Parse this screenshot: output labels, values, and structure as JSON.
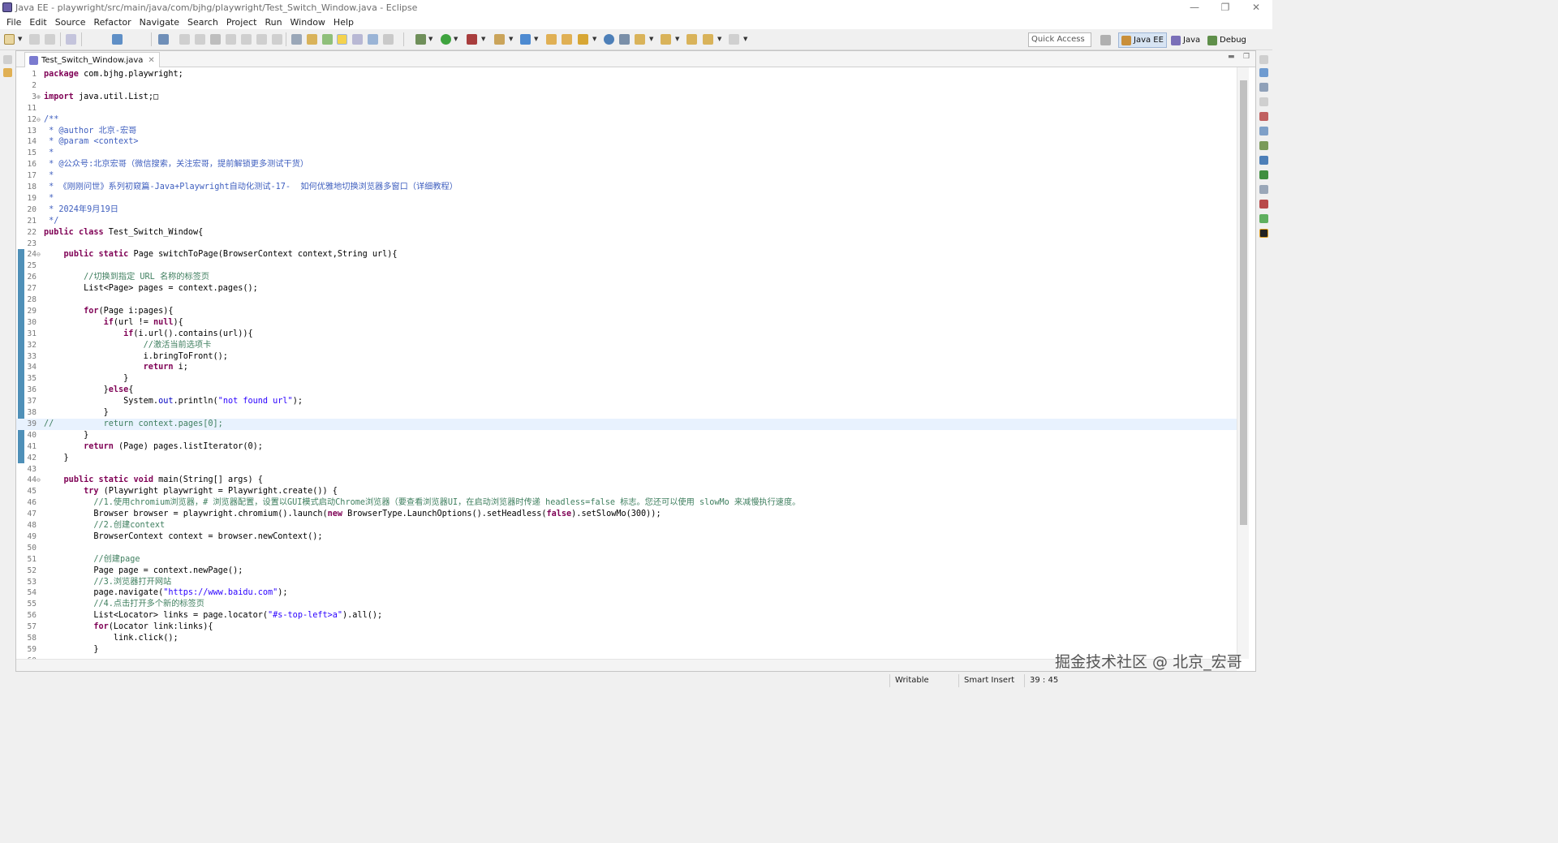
{
  "window": {
    "title": "Java EE - playwright/src/main/java/com/bjhg/playwright/Test_Switch_Window.java - Eclipse",
    "controls": [
      "—",
      "❐",
      "✕"
    ]
  },
  "menu": [
    "File",
    "Edit",
    "Source",
    "Refactor",
    "Navigate",
    "Search",
    "Project",
    "Run",
    "Window",
    "Help"
  ],
  "quick_access": {
    "placeholder": "Quick Access"
  },
  "perspectives": {
    "javaee": "Java EE",
    "java": "Java",
    "debug": "Debug"
  },
  "editor_tab": {
    "name": "Test_Switch_Window.java",
    "close": "✕"
  },
  "code_lines": [
    {
      "n": "1",
      "text": "package com.bjhg.playwright;"
    },
    {
      "n": "2",
      "text": ""
    },
    {
      "n": "3",
      "text": "import java.util.List;□",
      "fold": "⊕"
    },
    {
      "n": "11",
      "text": ""
    },
    {
      "n": "12",
      "text": "/**",
      "fold": "⊖"
    },
    {
      "n": "13",
      "text": " * @author 北京-宏哥"
    },
    {
      "n": "14",
      "text": " * @param <context>"
    },
    {
      "n": "15",
      "text": " *"
    },
    {
      "n": "16",
      "text": " * @公众号:北京宏哥（微信搜索，关注宏哥，提前解锁更多测试干货）"
    },
    {
      "n": "17",
      "text": " *"
    },
    {
      "n": "18",
      "text": " * 《刚刚问世》系列初窥篇-Java+Playwright自动化测试-17-  如何优雅地切换浏览器多窗口（详细教程）"
    },
    {
      "n": "19",
      "text": " *"
    },
    {
      "n": "20",
      "text": " * 2024年9月19日"
    },
    {
      "n": "21",
      "text": " */"
    },
    {
      "n": "22",
      "text": "public class Test_Switch_Window{"
    },
    {
      "n": "23",
      "text": ""
    },
    {
      "n": "24",
      "text": "    public static Page switchToPage(BrowserContext context,String url){",
      "fold": "⊖"
    },
    {
      "n": "25",
      "text": ""
    },
    {
      "n": "26",
      "text": "        //切换到指定 URL 名称的标签页"
    },
    {
      "n": "27",
      "text": "        List<Page> pages = context.pages();"
    },
    {
      "n": "28",
      "text": ""
    },
    {
      "n": "29",
      "text": "        for(Page i:pages){"
    },
    {
      "n": "30",
      "text": "            if(url != null){"
    },
    {
      "n": "31",
      "text": "                if(i.url().contains(url)){"
    },
    {
      "n": "32",
      "text": "                    //激活当前选项卡"
    },
    {
      "n": "33",
      "text": "                    i.bringToFront();"
    },
    {
      "n": "34",
      "text": "                    return i;"
    },
    {
      "n": "35",
      "text": "                }"
    },
    {
      "n": "36",
      "text": "            }else{"
    },
    {
      "n": "37",
      "text": "                System.out.println(\"not found url\");"
    },
    {
      "n": "38",
      "text": "            }"
    },
    {
      "n": "39",
      "text": "//          return context.pages[0];"
    },
    {
      "n": "40",
      "text": "        }"
    },
    {
      "n": "41",
      "text": "        return (Page) pages.listIterator(0);"
    },
    {
      "n": "42",
      "text": "    }"
    },
    {
      "n": "43",
      "text": ""
    },
    {
      "n": "44",
      "text": "    public static void main(String[] args) {",
      "fold": "⊖"
    },
    {
      "n": "45",
      "text": "        try (Playwright playwright = Playwright.create()) {"
    },
    {
      "n": "46",
      "text": "          //1.使用chromium浏览器，# 浏览器配置，设置以GUI模式启动Chrome浏览器（要查看浏览器UI，在启动浏览器时传递 headless=false 标志。您还可以使用 slowMo 来减慢执行速度。"
    },
    {
      "n": "47",
      "text": "          Browser browser = playwright.chromium().launch(new BrowserType.LaunchOptions().setHeadless(false).setSlowMo(300));"
    },
    {
      "n": "48",
      "text": "          //2.创建context"
    },
    {
      "n": "49",
      "text": "          BrowserContext context = browser.newContext();"
    },
    {
      "n": "50",
      "text": ""
    },
    {
      "n": "51",
      "text": "          //创建page"
    },
    {
      "n": "52",
      "text": "          Page page = context.newPage();"
    },
    {
      "n": "53",
      "text": "          //3.浏览器打开网站"
    },
    {
      "n": "54",
      "text": "          page.navigate(\"https://www.baidu.com\");"
    },
    {
      "n": "55",
      "text": "          //4.点击打开多个新的标签页"
    },
    {
      "n": "56",
      "text": "          List<Locator> links = page.locator(\"#s-top-left>a\").all();"
    },
    {
      "n": "57",
      "text": "          for(Locator link:links){"
    },
    {
      "n": "58",
      "text": "              link.click();"
    },
    {
      "n": "59",
      "text": "          }"
    },
    {
      "n": "60",
      "text": ""
    }
  ],
  "status": {
    "writable": "Writable",
    "insert_mode": "Smart Insert",
    "position": "39 : 45"
  },
  "watermark": "掘金技术社区 @ 北京_宏哥",
  "colors": {
    "keyword": "#7f0055",
    "comment": "#3f7f5f",
    "javadoc": "#3f5fbf",
    "string": "#2a00ff",
    "current_line": "#e8f2fe",
    "change_bar": "#4f90b8"
  }
}
